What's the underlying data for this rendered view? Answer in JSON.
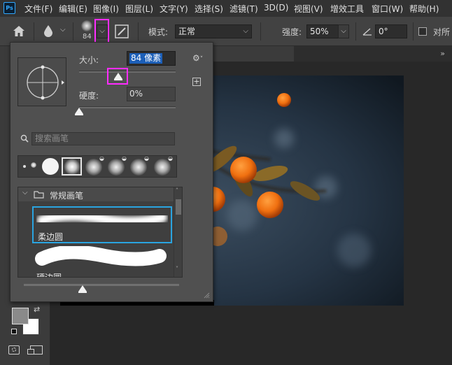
{
  "app": {
    "logo": "Ps"
  },
  "menu": {
    "items": [
      "文件(F)",
      "编辑(E)",
      "图像(I)",
      "图层(L)",
      "文字(Y)",
      "选择(S)",
      "滤镜(T)",
      "3D(D)",
      "视图(V)",
      "增效工具",
      "窗口(W)",
      "帮助(H)"
    ]
  },
  "options_bar": {
    "brush_size_value": "84",
    "mode_label": "模式:",
    "mode_value": "正常",
    "opacity_label": "强度:",
    "opacity_value": "50%",
    "angle_value": "0°",
    "sample_all_label": "对所"
  },
  "brush_panel": {
    "size_label": "大小:",
    "size_value": "84 像素",
    "hardness_label": "硬度:",
    "hardness_value": "0%",
    "search_placeholder": "搜索画笔",
    "group_name": "常规画笔",
    "brushes": [
      {
        "name": "柔边圆"
      },
      {
        "name": "硬边圆"
      }
    ]
  },
  "colors": {
    "accent": "#31a8ff",
    "highlight_box": "#ff2cff",
    "panel_bg": "#505050",
    "menubar_bg": "#323232"
  }
}
